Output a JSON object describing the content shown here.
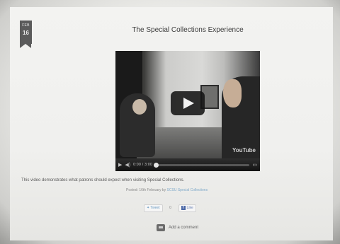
{
  "post": {
    "date_month": "FEB",
    "date_day": "16",
    "title": "The Special Collections Experience",
    "description": "This video demonstrates what patrons should expect when visiting Special Collections.",
    "posted_prefix": "Posted: 16th February by ",
    "author": "SCSU Special Collections"
  },
  "video": {
    "time": "0:00 / 3:00",
    "logo": "YouTube",
    "icons": [
      "play-icon",
      "volume-icon",
      "fullscreen-icon"
    ]
  },
  "share": {
    "tweet_label": "Tweet",
    "tweet_count": "0",
    "like_label": "Like"
  },
  "comments": {
    "add_label": "Add a comment"
  }
}
